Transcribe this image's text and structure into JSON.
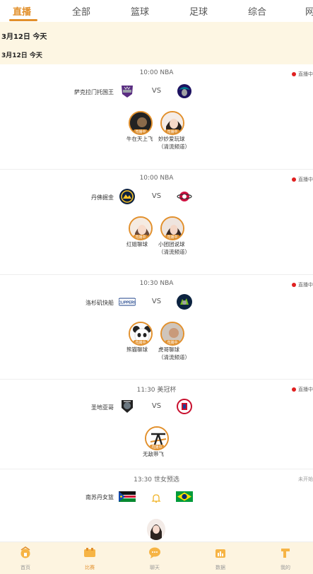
{
  "tabs": [
    {
      "label": "直播",
      "active": true
    },
    {
      "label": "全部"
    },
    {
      "label": "篮球"
    },
    {
      "label": "足球"
    },
    {
      "label": "综合"
    },
    {
      "label": "网"
    }
  ],
  "date_header": {
    "line1": "3月12日 今天",
    "line2": "3月12日 今天"
  },
  "matches": [
    {
      "time": "10:00 NBA",
      "status": "直播中",
      "home": "萨克拉门托国王",
      "away": "夏洛特黄蜂",
      "anchors": [
        {
          "name": "牛在天上飞",
          "badge": "直播中"
        },
        {
          "name": "妙妙爱玩球（清流频道）",
          "badge": "直播中"
        }
      ]
    },
    {
      "time": "10:00 NBA",
      "status": "直播中",
      "home": "丹佛掘金",
      "away": "休斯敦火箭",
      "anchors": [
        {
          "name": "红姐聊球",
          "badge": "直播中"
        },
        {
          "name": "小团团说球（清流频道）",
          "badge": "直播中"
        }
      ]
    },
    {
      "time": "10:30 NBA",
      "status": "直播中",
      "home": "洛杉矶快船",
      "away": "明尼苏达森林狼",
      "anchors": [
        {
          "name": "熊猫聊球",
          "badge": "直播中"
        },
        {
          "name": "虎哥聊球（清流频道）",
          "badge": "直播中"
        }
      ]
    },
    {
      "time": "11:30 美冠杯",
      "status": "直播中",
      "home": "圣地亚哥",
      "away": "托卢卡",
      "anchors": [
        {
          "name": "无敌带飞",
          "badge": "直播中"
        }
      ]
    },
    {
      "time": "13:30 世女预选",
      "status": "未开始",
      "home": "南苏丹女篮",
      "away": "巴西女篮",
      "anchors": []
    }
  ],
  "bottom_nav": [
    {
      "label": "首页",
      "icon": "home-icon"
    },
    {
      "label": "比赛",
      "icon": "match-icon"
    },
    {
      "label": "聊天",
      "icon": "chat-icon"
    },
    {
      "label": "数据",
      "icon": "data-icon"
    },
    {
      "label": "我的",
      "icon": "profile-icon"
    }
  ],
  "colors": {
    "accent": "#e2902c",
    "live_dot": "#e02020",
    "date_bg": "#fdf6e3",
    "nav_bg": "#fdf4e0"
  }
}
